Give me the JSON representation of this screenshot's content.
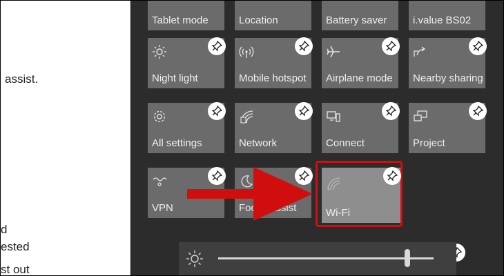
{
  "document": {
    "lines": [
      "assist.",
      "d",
      "ested",
      "st out"
    ]
  },
  "action_center": {
    "top_row_labels": [
      "Tablet mode",
      "Location",
      "Battery saver",
      "i.value BS02"
    ],
    "tiles": [
      {
        "label": "Night light",
        "icon": "brightness-icon"
      },
      {
        "label": "Mobile hotspot",
        "icon": "hotspot-icon"
      },
      {
        "label": "Airplane mode",
        "icon": "airplane-icon"
      },
      {
        "label": "Nearby sharing",
        "icon": "share-icon"
      },
      {
        "label": "All settings",
        "icon": "gear-icon"
      },
      {
        "label": "Network",
        "icon": "network-icon"
      },
      {
        "label": "Connect",
        "icon": "connect-icon"
      },
      {
        "label": "Project",
        "icon": "project-icon"
      },
      {
        "label": "VPN",
        "icon": "vpn-icon"
      },
      {
        "label": "Focus assist",
        "icon": "moon-icon"
      },
      {
        "label": "Wi-Fi",
        "icon": "wifi-icon"
      }
    ],
    "brightness": {
      "level": 0.88,
      "icon": "brightness-icon"
    }
  },
  "colors": {
    "panel_bg": "#2c2c2c",
    "tile_bg": "#6b6b6b",
    "tile_selected_bg": "#8e8e8e",
    "highlight": "#d10e0e",
    "arrow": "#d10e0e"
  }
}
